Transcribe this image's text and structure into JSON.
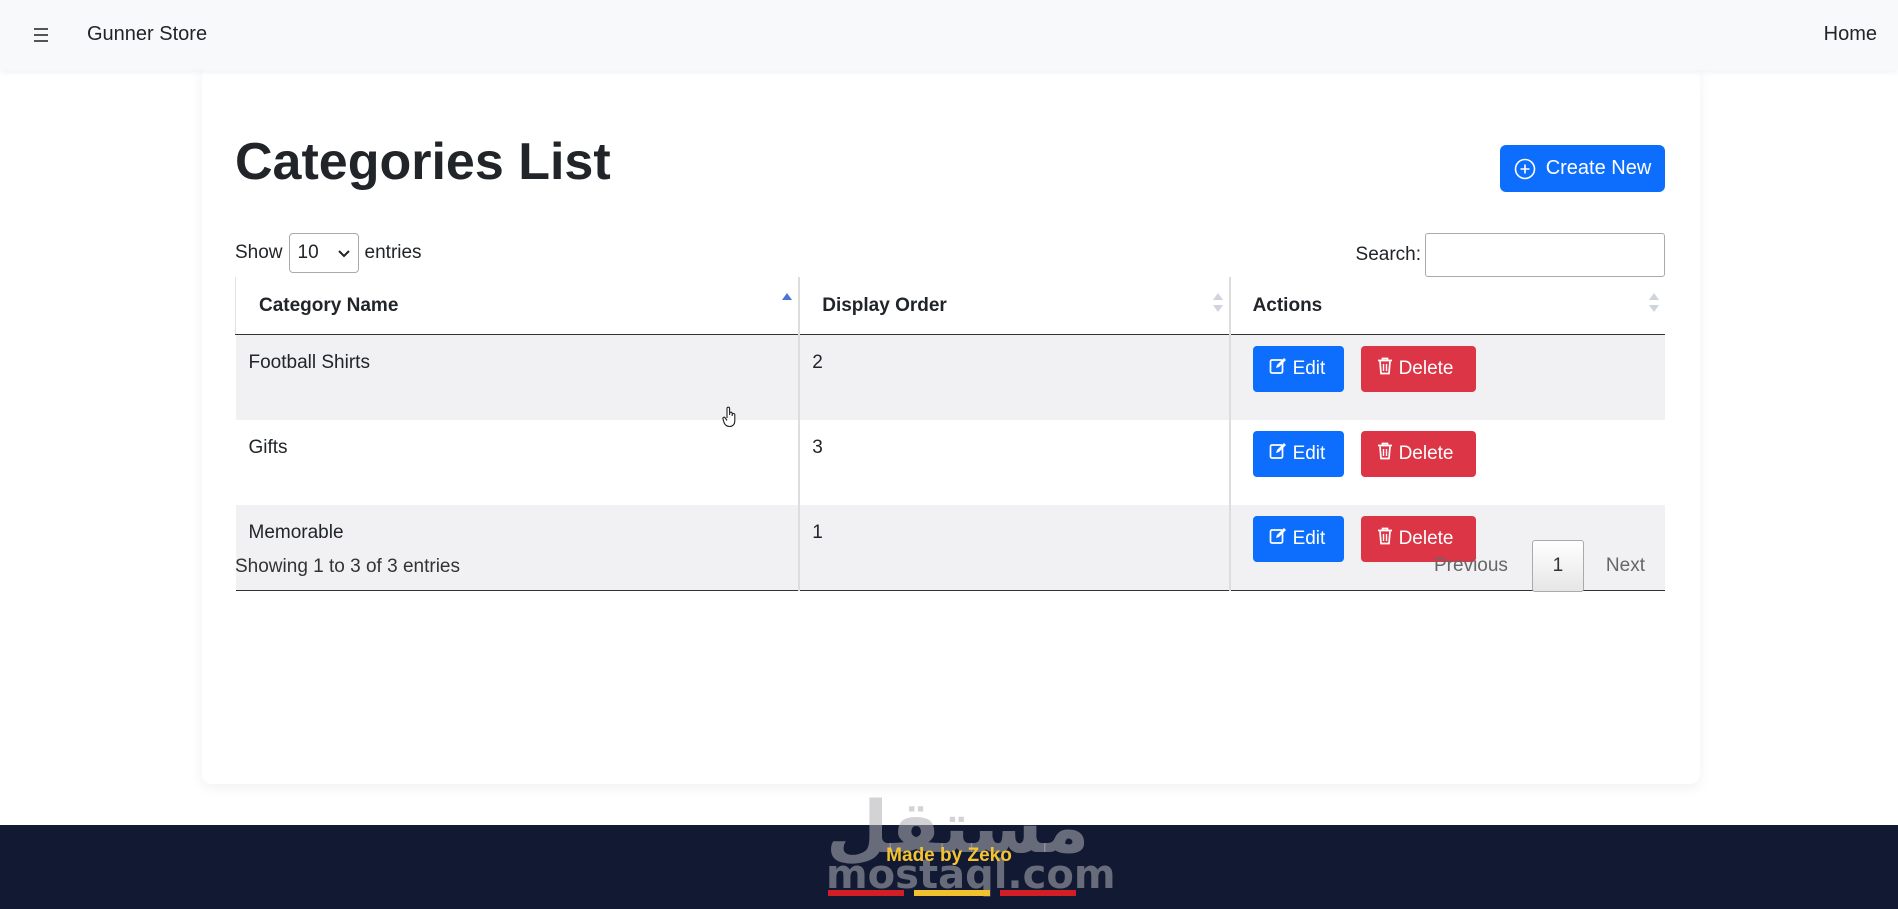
{
  "navbar": {
    "menu_icon": "hamburger-icon",
    "brand": "Gunner Store",
    "home_link": "Home"
  },
  "page": {
    "title": "Categories List",
    "create_label": "Create New",
    "create_icon": "plus-circle-icon"
  },
  "table_controls": {
    "show_label": "Show",
    "entries_value": "10",
    "entries_label": "entries",
    "search_label": "Search:",
    "search_value": ""
  },
  "table": {
    "columns": [
      {
        "label": "Category Name",
        "sort": "ascending"
      },
      {
        "label": "Display Order",
        "sort": "none"
      },
      {
        "label": "Actions",
        "sort": "none"
      }
    ],
    "rows": [
      {
        "name": "Football Shirts",
        "order": "2"
      },
      {
        "name": "Gifts",
        "order": "3"
      },
      {
        "name": "Memorable",
        "order": "1"
      }
    ],
    "edit_label": "Edit",
    "delete_label": "Delete",
    "edit_icon": "pencil-square-icon",
    "delete_icon": "trash-icon"
  },
  "pagination": {
    "info": "Showing 1 to 3 of 3 entries",
    "previous": "Previous",
    "current_page": "1",
    "next": "Next"
  },
  "footer": {
    "made_by": "Made by Zeko",
    "watermark_arabic": "مستقل",
    "watermark_latin": "mostaql.com"
  },
  "colors": {
    "primary": "#0d6efd",
    "danger": "#dc3545",
    "footer_bg": "#121a33",
    "made_by_text": "#f4c430",
    "stripe_red": "#d21f26",
    "stripe_yellow": "#f2c12e"
  }
}
